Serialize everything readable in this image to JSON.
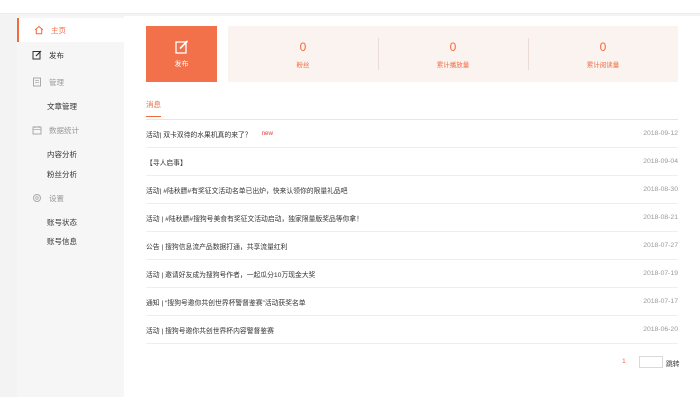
{
  "sidebar": {
    "items": [
      {
        "label": "主页",
        "icon": "home-icon",
        "type": "active"
      },
      {
        "label": "发布",
        "icon": "edit-icon",
        "type": "item"
      },
      {
        "label": "管理",
        "icon": "document-icon",
        "type": "group"
      },
      {
        "label": "文章管理",
        "type": "sub"
      },
      {
        "label": "数据统计",
        "icon": "calendar-icon",
        "type": "group"
      },
      {
        "label": "内容分析",
        "type": "sub"
      },
      {
        "label": "粉丝分析",
        "type": "sub"
      },
      {
        "label": "设置",
        "icon": "settings-icon",
        "type": "group"
      },
      {
        "label": "账号状态",
        "type": "sub"
      },
      {
        "label": "账号信息",
        "type": "sub"
      }
    ]
  },
  "publish": {
    "label": "发布",
    "icon": "edit-icon"
  },
  "stats": [
    {
      "value": "0",
      "label": "粉丝"
    },
    {
      "value": "0",
      "label": "累计播放量"
    },
    {
      "value": "0",
      "label": "累计阅读量"
    }
  ],
  "tabs": {
    "messages": "消息"
  },
  "messages": [
    {
      "title": "活动| 双卡双待的水果机真的来了？",
      "badge": "new",
      "date": "2018-09-12"
    },
    {
      "title": "【寻人启事】",
      "badge": "",
      "date": "2018-09-04"
    },
    {
      "title": "活动| #陆秋膘#有奖征文活动名单已出炉，快来认领你的限量礼品吧",
      "badge": "",
      "date": "2018-08-30"
    },
    {
      "title": "活动 | #陆秋膘#搜狗号美食有奖征文活动启动，独家限量版奖品等你拿！",
      "badge": "",
      "date": "2018-08-21"
    },
    {
      "title": "公告 | 搜狗信息流产品数据打通，共享流量红利",
      "badge": "",
      "date": "2018-07-27"
    },
    {
      "title": "活动 | 邀请好友成为搜狗号作者，一起瓜分10万现金大奖",
      "badge": "",
      "date": "2018-07-19"
    },
    {
      "title": "通知 | “搜狗号邀你共创世界杯警督鉴赛”活动获奖名单",
      "badge": "",
      "date": "2018-07-17"
    },
    {
      "title": "活动 | 搜狗号邀你共创世界杯内容警督鉴赛",
      "badge": "",
      "date": "2018-06-20"
    }
  ],
  "pagination": {
    "current": "1",
    "jump_label": "跳转"
  },
  "colors": {
    "accent": "#f26a3f",
    "publish_bg": "#f2714a",
    "stats_bg": "#fbf3ef"
  }
}
